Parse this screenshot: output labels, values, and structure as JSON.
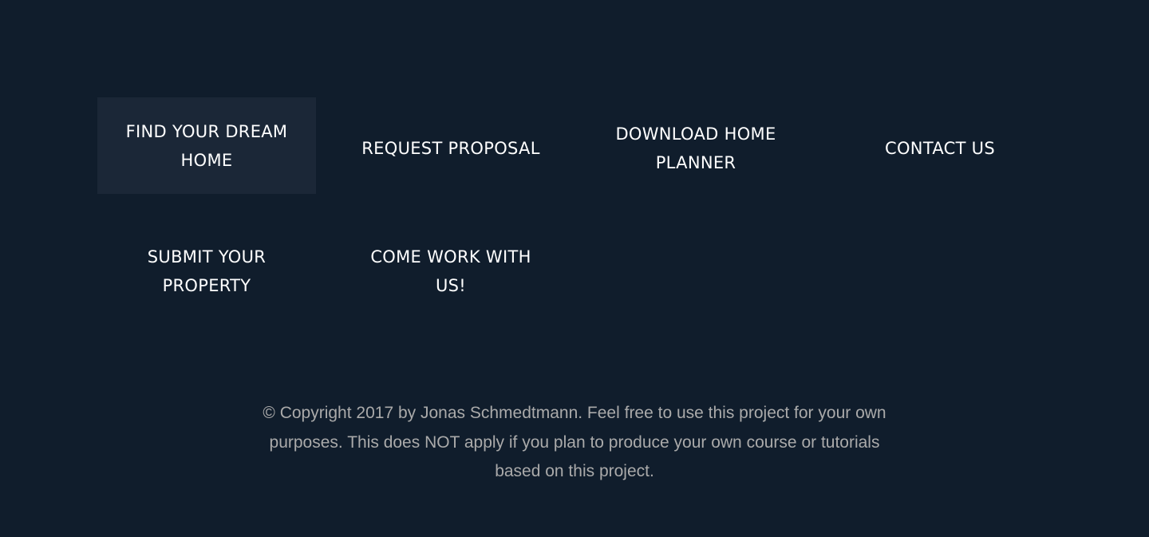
{
  "footer": {
    "nav": [
      {
        "label": "Find your dream home",
        "display": "FIND YOUR DREAM HOME"
      },
      {
        "label": "Request proposal",
        "display": "REQUEST PROPOSAL"
      },
      {
        "label": "Download home planner",
        "display": "DOWNLOAD HOME PLANNER"
      },
      {
        "label": "Contact us",
        "display": "CONTACT US"
      },
      {
        "label": "Submit your property",
        "display": "SUBMIT YOUR PROPERTY"
      },
      {
        "label": "Come work with us!",
        "display": "COME WORK WITH US!"
      }
    ],
    "copyright": "© Copyright 2017 by Jonas Schmedtmann. Feel free to use this project for your own purposes. This does NOT apply if you plan to produce your own course or tutorials based on this project."
  },
  "colors": {
    "background": "#101d2c",
    "active_link_bg": "#1b2737",
    "link_text": "#ffffff",
    "copyright_text": "#aaaaaa"
  }
}
